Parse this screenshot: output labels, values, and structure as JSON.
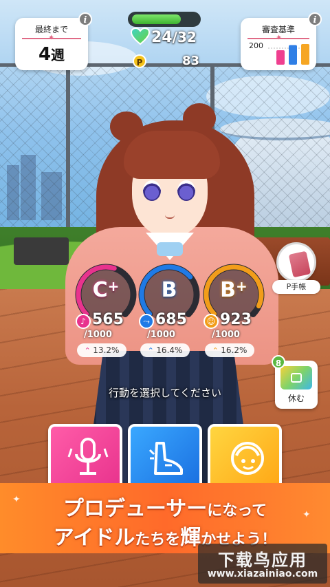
{
  "hud": {
    "weeks": {
      "title": "最終まで",
      "value": "4",
      "unit": "週"
    },
    "stamina": {
      "current": "24",
      "separator": "/",
      "max": "32",
      "fill_fraction": 0.75
    },
    "points": {
      "icon_label": "P",
      "value": "83"
    },
    "criteria": {
      "title": "審査基準",
      "axis_label": "200",
      "bars": [
        {
          "name": "vocal",
          "value": 0.7,
          "color": "#ef3f8f"
        },
        {
          "name": "dance",
          "value": 0.95,
          "color": "#2f7fe6"
        },
        {
          "name": "visual",
          "value": 1.0,
          "color": "#f6a623"
        }
      ]
    },
    "info_icon": "i"
  },
  "stats": [
    {
      "name": "vocal",
      "grade": "C",
      "plus": "+",
      "value": "565",
      "max": "/1000",
      "growth": "13.2%",
      "fraction": 0.565,
      "color": "#e8338d",
      "icon": "mic-icon",
      "icon_glyph": "♪"
    },
    {
      "name": "dance",
      "grade": "B",
      "plus": "",
      "value": "685",
      "max": "/1000",
      "growth": "16.4%",
      "fraction": 0.685,
      "color": "#1f7ae6",
      "icon": "shoe-icon",
      "icon_glyph": "⤳"
    },
    {
      "name": "visual",
      "grade": "B",
      "plus": "+",
      "value": "923",
      "max": "/1000",
      "growth": "16.2%",
      "fraction": 0.923,
      "color": "#f29d1a",
      "icon": "face-icon",
      "icon_glyph": "☺"
    }
  ],
  "side": {
    "pnote_label": "P手帳",
    "rest_label": "休む",
    "rest_badge": "8"
  },
  "prompt": "行動を選択してください",
  "actions": [
    {
      "name": "vocal",
      "icon": "microphone-icon"
    },
    {
      "name": "dance",
      "icon": "shoe-icon"
    },
    {
      "name": "visual",
      "icon": "visual-face-icon"
    }
  ],
  "banner": {
    "line1_main": "プロデューサー",
    "line1_small": "になって",
    "line2_main1": "アイドル",
    "line2_small1": "たちを",
    "line2_main2": "輝",
    "line2_small2": "かせよう！"
  },
  "watermark": {
    "main": "下载鸟应用",
    "url": "www.xiazainiao.com"
  }
}
